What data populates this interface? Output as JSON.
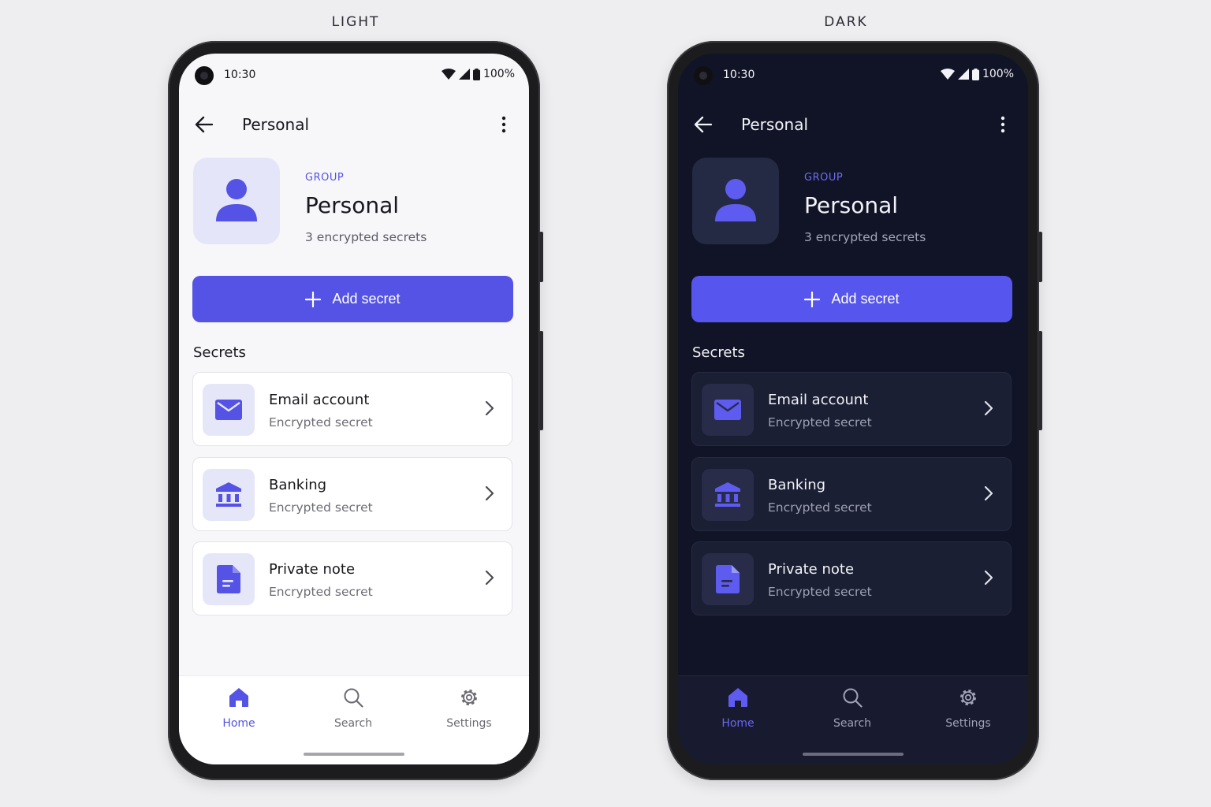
{
  "labels": {
    "light": "LIGHT",
    "dark": "DARK"
  },
  "colors": {
    "accent": "#5453e6",
    "light_bg": "#f7f7fa",
    "dark_bg": "#111426"
  },
  "status": {
    "time": "10:30",
    "battery": "100%"
  },
  "appbar": {
    "title": "Personal",
    "back_icon": "arrow-left-icon",
    "menu_icon": "more-vert-icon"
  },
  "group": {
    "label": "GROUP",
    "name": "Personal",
    "subtitle": "3 encrypted secrets",
    "icon": "person-icon"
  },
  "add_button": {
    "label": "Add secret",
    "icon": "plus-icon"
  },
  "secrets_section": {
    "title": "Secrets"
  },
  "secrets": [
    {
      "name": "Email account",
      "subtitle": "Encrypted secret",
      "icon": "mail-icon"
    },
    {
      "name": "Banking",
      "subtitle": "Encrypted secret",
      "icon": "bank-icon"
    },
    {
      "name": "Private note",
      "subtitle": "Encrypted secret",
      "icon": "document-icon"
    }
  ],
  "nav": [
    {
      "label": "Home",
      "icon": "home-icon",
      "active": true
    },
    {
      "label": "Search",
      "icon": "search-icon",
      "active": false
    },
    {
      "label": "Settings",
      "icon": "gear-icon",
      "active": false
    }
  ]
}
